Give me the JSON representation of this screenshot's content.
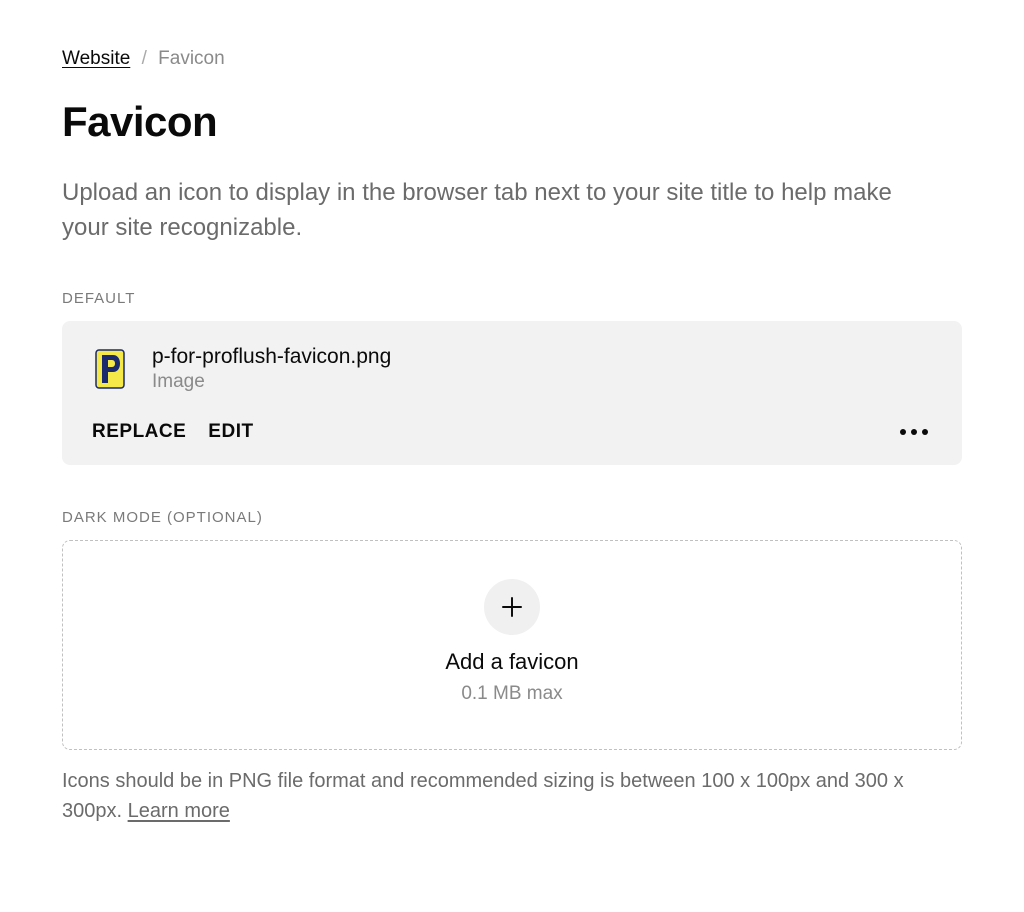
{
  "breadcrumb": {
    "root": "Website",
    "separator": "/",
    "current": "Favicon"
  },
  "title": "Favicon",
  "description": "Upload an icon to display in the browser tab next to your site title to help make your site recognizable.",
  "sections": {
    "default": {
      "label": "DEFAULT",
      "file": {
        "name": "p-for-proflush-favicon.png",
        "type": "Image"
      },
      "actions": {
        "replace": "REPLACE",
        "edit": "EDIT"
      }
    },
    "dark": {
      "label": "DARK MODE (OPTIONAL)",
      "dropzone": {
        "title": "Add a favicon",
        "subtitle": "0.1 MB max"
      }
    }
  },
  "help": {
    "text": "Icons should be in PNG file format and recommended sizing is between 100 x 100px and 300 x 300px. ",
    "link": "Learn more"
  }
}
